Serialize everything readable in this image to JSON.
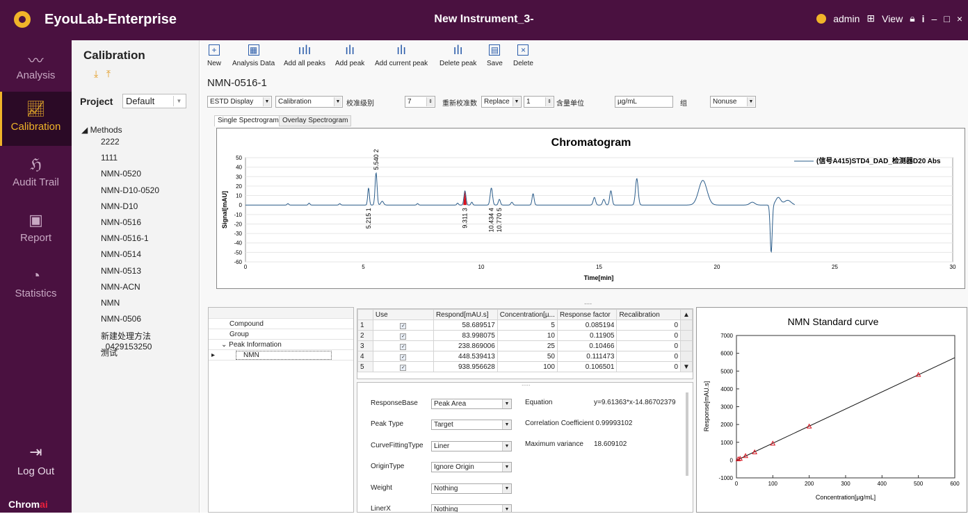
{
  "app": {
    "name": "EyouLab-Enterprise",
    "window_title": "New Instrument_3-",
    "user": "admin",
    "view_label": "View",
    "info_icon": "i",
    "min_icon": "–",
    "max_icon": "□",
    "close_icon": "×"
  },
  "nav": {
    "items": [
      {
        "label": "Analysis",
        "icon": "pulse-icon"
      },
      {
        "label": "Calibration",
        "icon": "chart-icon",
        "active": true
      },
      {
        "label": "Audit Trail",
        "icon": "fingerprint-icon"
      },
      {
        "label": "Report",
        "icon": "report-icon"
      },
      {
        "label": "Statistics",
        "icon": "pie-icon"
      }
    ],
    "logout": "Log Out",
    "brand_main": "Chrom",
    "brand_accent": "ai"
  },
  "left": {
    "title": "Calibration",
    "project_label": "Project",
    "project_value": "Default",
    "tree_root": "Methods",
    "methods": [
      "2222",
      "1111",
      "NMN-0520",
      "NMN-D10-0520",
      "NMN-D10",
      "NMN-0516",
      "NMN-0516-1",
      "NMN-0514",
      "NMN-0513",
      "NMN-ACN",
      "NMN",
      "NMN-0506",
      "新建处理方法_0429153250",
      "测试"
    ]
  },
  "toolbar": {
    "items": [
      "New",
      "Analysis Data",
      "Add all peaks",
      "Add peak",
      "Add current peak",
      "Delete peak",
      "Save",
      "Delete"
    ]
  },
  "main": {
    "method_title": "NMN-0516-1",
    "controls": {
      "display": "ESTD Display",
      "mode": "Calibration",
      "level_label": "校准级别",
      "level_value": "7",
      "recal_label": "重新校准数",
      "recal_mode": "Replace",
      "recal_value": "1",
      "unit_label": "含量单位",
      "unit_value": "µg/mL",
      "group_label": "组",
      "group_value": "Nonuse"
    },
    "tabs": [
      "Single Spectrogram",
      "Overlay Spectrogram"
    ],
    "separator": "....",
    "grid_dots": "....."
  },
  "chromatogram": {
    "title": "Chromatogram",
    "ylabel": "Signal[mAU]",
    "xlabel": "Time[min]",
    "legend": "(信号A415)STD4_DAD_检测器D20 Abs",
    "x_ticks": [
      "0",
      "5",
      "10",
      "15",
      "20",
      "25",
      "30"
    ],
    "y_ticks": [
      "50",
      "40",
      "30",
      "20",
      "10",
      "0",
      "-10",
      "-20",
      "-30",
      "-40",
      "-50",
      "-60"
    ],
    "peak_labels": [
      "5.215  1",
      "5.540  2",
      "9.311  3",
      "10.434  4",
      "10.770  5"
    ]
  },
  "compound_tree": {
    "rows": [
      "Compound",
      "Group",
      "Peak Information",
      "NMN"
    ]
  },
  "grid": {
    "headers": [
      "Use",
      "Respond[mAU.s]",
      "Concentration[µ...",
      "Response factor",
      "Recalibration"
    ],
    "rows": [
      [
        "1",
        "58.689517",
        "5",
        "0.085194",
        "0"
      ],
      [
        "2",
        "83.998075",
        "10",
        "0.11905",
        "0"
      ],
      [
        "3",
        "238.869006",
        "25",
        "0.10466",
        "0"
      ],
      [
        "4",
        "448.539413",
        "50",
        "0.111473",
        "0"
      ],
      [
        "5",
        "938.956628",
        "100",
        "0.106501",
        "0"
      ]
    ]
  },
  "props": {
    "rows": [
      {
        "label": "ResponseBase",
        "value": "Peak Area"
      },
      {
        "label": "Peak Type",
        "value": "Target"
      },
      {
        "label": "CurveFittingType",
        "value": "Liner"
      },
      {
        "label": "OriginType",
        "value": "Ignore Origin"
      },
      {
        "label": "Weight",
        "value": "Nothing"
      },
      {
        "label": "LinerX",
        "value": "Nothing"
      }
    ],
    "equation_label": "Equation",
    "equation_value": "y=9.61363*x-14.86702379",
    "corr_label": "Correlation Coefficient",
    "corr_value": "0.99993102",
    "var_label": "Maximum variance",
    "var_value": "18.609102"
  },
  "chart_data": {
    "type": "scatter",
    "title": "NMN  Standard curve",
    "xlabel": "Concentration[µg/mL]",
    "ylabel": "Response[mAU.s]",
    "xlim": [
      0,
      600
    ],
    "ylim": [
      -1000,
      7000
    ],
    "x_ticks": [
      "0",
      "100",
      "200",
      "300",
      "400",
      "500",
      "600"
    ],
    "y_ticks": [
      "7000",
      "6000",
      "5000",
      "4000",
      "3000",
      "2000",
      "1000",
      "0",
      "-1000"
    ],
    "points": [
      [
        5,
        58.7
      ],
      [
        10,
        84.0
      ],
      [
        25,
        238.9
      ],
      [
        50,
        448.5
      ],
      [
        100,
        938.96
      ],
      [
        200,
        1900
      ],
      [
        500,
        4800
      ]
    ],
    "fit": {
      "slope": 9.61363,
      "intercept": -14.86702379
    }
  }
}
